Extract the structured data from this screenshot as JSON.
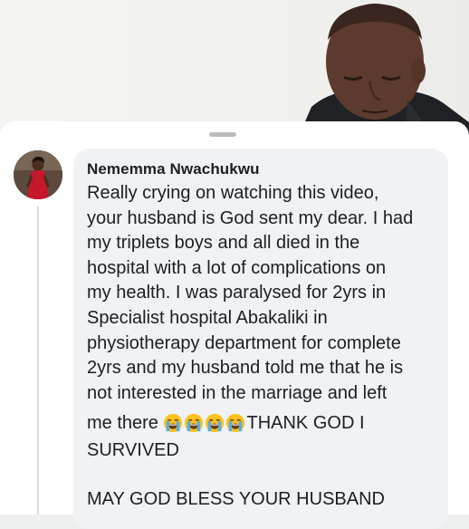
{
  "comment": {
    "author": "Nememma Nwachukwu",
    "lines": [
      "Really crying on watching this video,",
      "your husband is God sent my dear. I had",
      "my triplets boys and all died in the",
      "hospital with a lot of complications on",
      "my health. I was paralysed for 2yrs in",
      "Specialist hospital Abakaliki in",
      "physiotherapy department for complete",
      "2yrs and my husband told me that he is",
      "not interested in the marriage and left"
    ],
    "before_emoji": "me there ",
    "emoji_count": 4,
    "emoji_name": "loudly-crying-face-icon",
    "after_emoji": "THANK GOD I",
    "line_after": "SURVIVED",
    "final_line": "MAY GOD BLESS YOUR HUSBAND"
  },
  "colors": {
    "bubble": "#f0f2f5",
    "text": "#1c1e21",
    "sheet": "#ffffff"
  }
}
